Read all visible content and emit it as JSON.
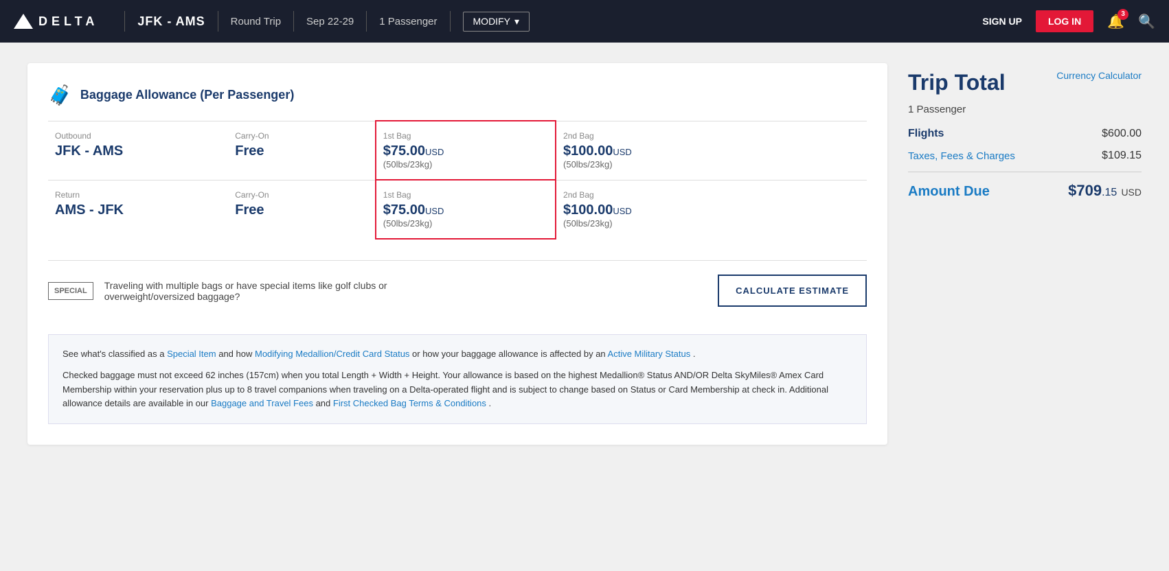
{
  "header": {
    "logo_text": "DELTA",
    "route": "JFK - AMS",
    "trip_type": "Round Trip",
    "dates": "Sep 22-29",
    "passengers": "1 Passenger",
    "modify_label": "MODIFY",
    "signup_label": "SIGN UP",
    "login_label": "LOG IN",
    "bell_count": "3"
  },
  "baggage": {
    "section_title": "Baggage Allowance (Per Passenger)",
    "outbound_label": "Outbound",
    "outbound_route": "JFK - AMS",
    "return_label": "Return",
    "return_route": "AMS - JFK",
    "carryon_label": "Carry-On",
    "carryon_value": "Free",
    "first_bag_label": "1st Bag",
    "first_bag_price": "$75.00",
    "first_bag_usd": "USD",
    "first_bag_weight": "(50lbs/23kg)",
    "second_bag_label": "2nd Bag",
    "second_bag_price": "$100.00",
    "second_bag_usd": "USD",
    "second_bag_weight": "(50lbs/23kg)"
  },
  "special_section": {
    "icon_text": "SPECIAL",
    "description": "Traveling with multiple bags or have special items like golf clubs or overweight/oversized baggage?",
    "calc_btn_label": "CALCULATE ESTIMATE"
  },
  "info_box": {
    "line1_prefix": "See what's classified as a ",
    "special_item_link": "Special Item",
    "line1_mid": " and how ",
    "medallion_link": "Modifying Medallion/Credit Card Status",
    "line1_suffix": " or how your baggage allowance is affected by an ",
    "military_link": "Active Military Status",
    "line1_end": " .",
    "paragraph2": "Checked baggage must not exceed 62 inches (157cm) when you total Length + Width + Height. Your allowance is based on the highest Medallion® Status AND/OR Delta SkyMiles® Amex Card Membership within your reservation plus up to 8 travel companions when traveling on a Delta-operated flight and is subject to change based on Status or Card Membership at check in. Additional allowance details are available in our ",
    "baggage_fees_link": "Baggage and Travel Fees",
    "paragraph2_mid": " and ",
    "first_bag_terms_link": "First Checked Bag Terms & Conditions",
    "paragraph2_end": " ."
  },
  "trip_total": {
    "title": "Trip Total",
    "currency_calc_label": "Currency Calculator",
    "passenger_label": "1 Passenger",
    "flights_label": "Flights",
    "flights_value": "$600.00",
    "taxes_label": "Taxes, Fees & Charges",
    "taxes_value": "$109.15",
    "amount_due_label": "Amount Due",
    "amount_due_dollars": "$709",
    "amount_due_cents": ".15",
    "amount_due_usd": "USD"
  }
}
